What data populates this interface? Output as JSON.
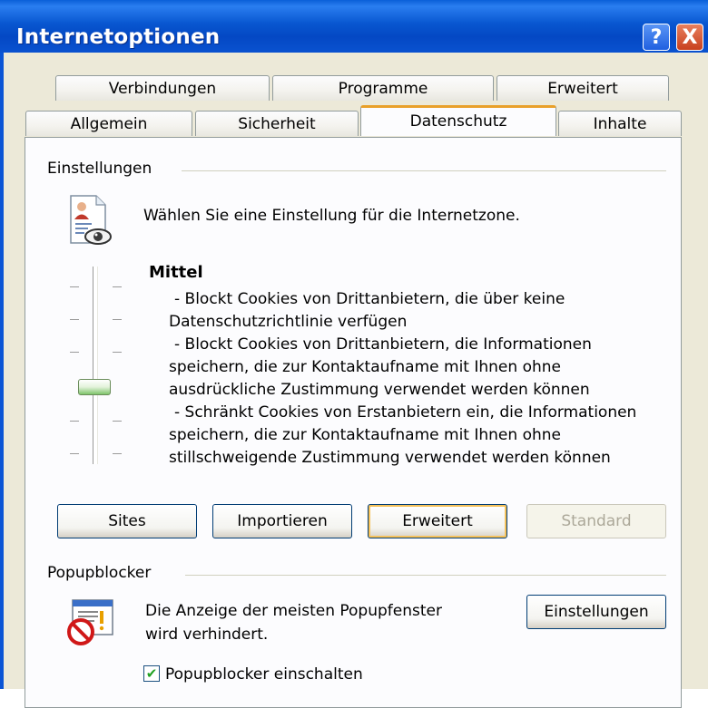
{
  "window": {
    "title": "Internetoptionen"
  },
  "titlebar_buttons": {
    "help": "?",
    "close": "X"
  },
  "tabs_row1": [
    "Verbindungen",
    "Programme",
    "Erweitert"
  ],
  "tabs_row2": [
    "Allgemein",
    "Sicherheit",
    "Datenschutz",
    "Inhalte"
  ],
  "active_tab": "Datenschutz",
  "settings": {
    "group_label": "Einstellungen",
    "intro": "Wählen Sie eine Einstellung für die Internetzone.",
    "level_title": "Mittel",
    "description_lines": [
      "- Blockt Cookies von Drittanbietern, die über keine",
      "Datenschutzrichtlinie verfügen",
      "- Blockt Cookies von Drittanbietern, die Informationen",
      "speichern, die zur Kontaktaufname mit Ihnen ohne",
      "ausdrückliche Zustimmung verwendet werden können",
      "- Schränkt Cookies von Erstanbietern ein, die Informationen",
      "speichern, die zur Kontaktaufname mit Ihnen ohne",
      "stillschweigende Zustimmung verwendet werden können"
    ],
    "slider_level": 0.5
  },
  "buttons": {
    "sites": "Sites",
    "import": "Importieren",
    "advanced": "Erweitert",
    "default": "Standard"
  },
  "popup": {
    "group_label": "Popupblocker",
    "text_line1": "Die Anzeige der meisten Popupfenster",
    "text_line2": "wird verhindert.",
    "settings_button": "Einstellungen",
    "checkbox_label": "Popupblocker einschalten",
    "checkbox_checked": true
  },
  "icons": {
    "privacy": "privacy-document-eye-icon",
    "popup": "popup-blocked-icon",
    "check": "checkmark-icon"
  }
}
